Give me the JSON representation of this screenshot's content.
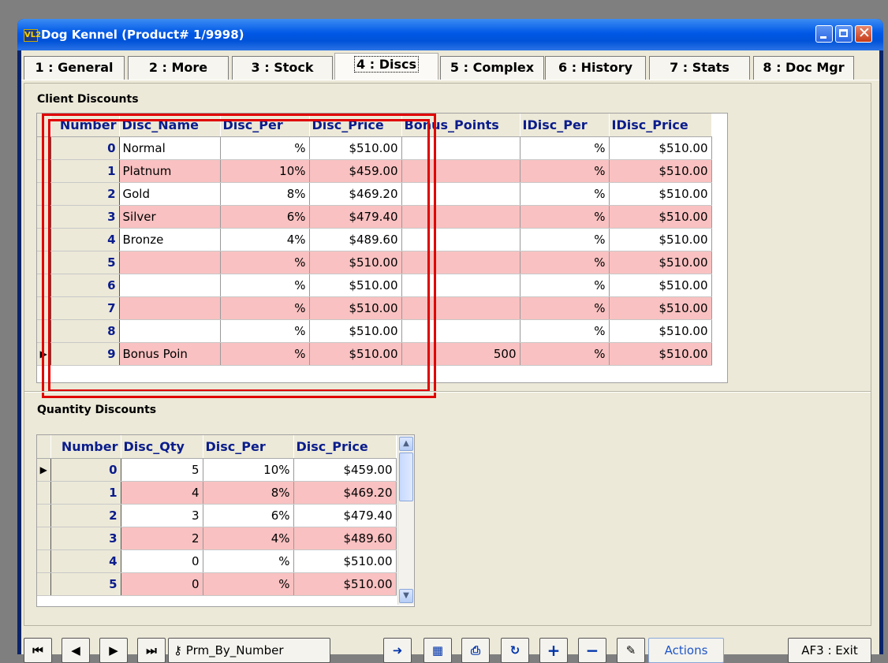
{
  "window": {
    "title": "Dog Kennel (Product# 1/9998)",
    "app_icon_text": "VL2",
    "controls": [
      "minimize-icon",
      "maximize-icon",
      "close-icon"
    ],
    "close_glyph": "✕"
  },
  "tabs": [
    {
      "label": "1 : General",
      "active": false
    },
    {
      "label": "2 : More",
      "active": false
    },
    {
      "label": "3 : Stock",
      "active": false
    },
    {
      "label": "4 : Discs",
      "active": true
    },
    {
      "label": "5 : Complex",
      "active": false
    },
    {
      "label": "6 : History",
      "active": false
    },
    {
      "label": "7 : Stats",
      "active": false
    },
    {
      "label": "8 : Doc Mgr",
      "active": false
    }
  ],
  "client_discounts": {
    "label": "Client Discounts",
    "columns": [
      "Number",
      "Disc_Name",
      "Disc_Per",
      "Disc_Price",
      "Bonus_Points",
      "IDisc_Per",
      "IDisc_Price"
    ],
    "rows": [
      {
        "indicator": "",
        "number": "0",
        "name": "Normal",
        "per": "%",
        "price": "$510.00",
        "bonus": "",
        "iper": "%",
        "iprice": "$510.00"
      },
      {
        "indicator": "",
        "number": "1",
        "name": "Platnum",
        "per": "10%",
        "price": "$459.00",
        "bonus": "",
        "iper": "%",
        "iprice": "$510.00"
      },
      {
        "indicator": "",
        "number": "2",
        "name": "Gold",
        "per": "8%",
        "price": "$469.20",
        "bonus": "",
        "iper": "%",
        "iprice": "$510.00"
      },
      {
        "indicator": "",
        "number": "3",
        "name": "Silver",
        "per": "6%",
        "price": "$479.40",
        "bonus": "",
        "iper": "%",
        "iprice": "$510.00"
      },
      {
        "indicator": "",
        "number": "4",
        "name": "Bronze",
        "per": "4%",
        "price": "$489.60",
        "bonus": "",
        "iper": "%",
        "iprice": "$510.00"
      },
      {
        "indicator": "",
        "number": "5",
        "name": "",
        "per": "%",
        "price": "$510.00",
        "bonus": "",
        "iper": "%",
        "iprice": "$510.00"
      },
      {
        "indicator": "",
        "number": "6",
        "name": "",
        "per": "%",
        "price": "$510.00",
        "bonus": "",
        "iper": "%",
        "iprice": "$510.00"
      },
      {
        "indicator": "",
        "number": "7",
        "name": "",
        "per": "%",
        "price": "$510.00",
        "bonus": "",
        "iper": "%",
        "iprice": "$510.00"
      },
      {
        "indicator": "",
        "number": "8",
        "name": "",
        "per": "%",
        "price": "$510.00",
        "bonus": "",
        "iper": "%",
        "iprice": "$510.00"
      },
      {
        "indicator": "▶",
        "number": "9",
        "name": "Bonus Poin",
        "per": "%",
        "price": "$510.00",
        "bonus": "500",
        "iper": "%",
        "iprice": "$510.00"
      }
    ]
  },
  "quantity_discounts": {
    "label": "Quantity Discounts",
    "columns": [
      "Number",
      "Disc_Qty",
      "Disc_Per",
      "Disc_Price"
    ],
    "rows": [
      {
        "indicator": "▶",
        "number": "0",
        "qty": "5",
        "per": "10%",
        "price": "$459.00"
      },
      {
        "indicator": "",
        "number": "1",
        "qty": "4",
        "per": "8%",
        "price": "$469.20"
      },
      {
        "indicator": "",
        "number": "2",
        "qty": "3",
        "per": "6%",
        "price": "$479.40"
      },
      {
        "indicator": "",
        "number": "3",
        "qty": "2",
        "per": "4%",
        "price": "$489.60"
      },
      {
        "indicator": "",
        "number": "4",
        "qty": "0",
        "per": "%",
        "price": "$510.00"
      },
      {
        "indicator": "",
        "number": "5",
        "qty": "0",
        "per": "%",
        "price": "$510.00"
      }
    ],
    "scroll_up": "▲",
    "scroll_down": "▼"
  },
  "toolbar": {
    "first_glyph": "⏮",
    "prev_glyph": "◀",
    "next_glyph": "▶",
    "last_glyph": "⏭",
    "key_glyph": "⚷",
    "sort_label": "Prm_By_Number",
    "goto_glyph": "➜",
    "grid_glyph": "▦",
    "print_glyph": "⎙",
    "refresh_glyph": "↻",
    "add_glyph": "+",
    "delete_glyph": "−",
    "edit_glyph": "✎",
    "actions_label": "Actions",
    "exit_label": "AF3 : Exit"
  },
  "colors": {
    "titlebar": "#0058e6",
    "row_alt": "#f9c1c1",
    "header_text": "#0a1c8c",
    "highlight": "#e00000"
  }
}
